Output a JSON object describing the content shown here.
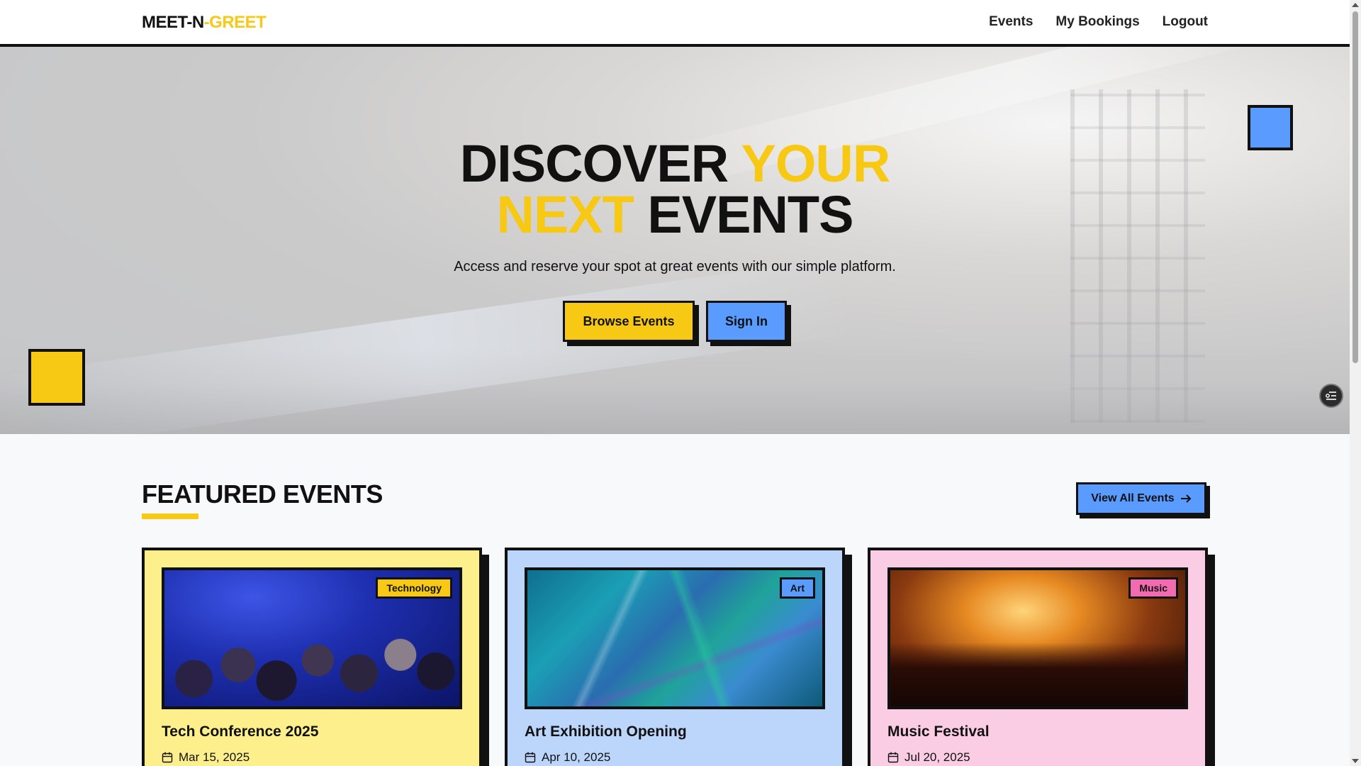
{
  "header": {
    "logo_part1": "MEET-N",
    "logo_part2": "-GREET",
    "nav": [
      "Events",
      "My Bookings",
      "Logout"
    ]
  },
  "hero": {
    "title_line1_a": "DISCOVER",
    "title_line1_b": "YOUR",
    "title_line2_a": "NEXT",
    "title_line2_b": "EVENTS",
    "subtitle": "Access and reserve your spot at great events with our simple platform.",
    "browse_label": "Browse Events",
    "signin_label": "Sign In"
  },
  "featured": {
    "title": "FEATURED EVENTS",
    "view_all_label": "View All Events",
    "cards": [
      {
        "category": "Technology",
        "title": "Tech Conference 2025",
        "date": "Mar 15, 2025"
      },
      {
        "category": "Art",
        "title": "Art Exhibition Opening",
        "date": "Apr 10, 2025"
      },
      {
        "category": "Music",
        "title": "Music Festival",
        "date": "Jul 20, 2025"
      }
    ]
  },
  "colors": {
    "accent_yellow": "#f7c914",
    "accent_blue": "#5a9bff",
    "accent_pink": "#f26ab0",
    "ink": "#111111"
  }
}
